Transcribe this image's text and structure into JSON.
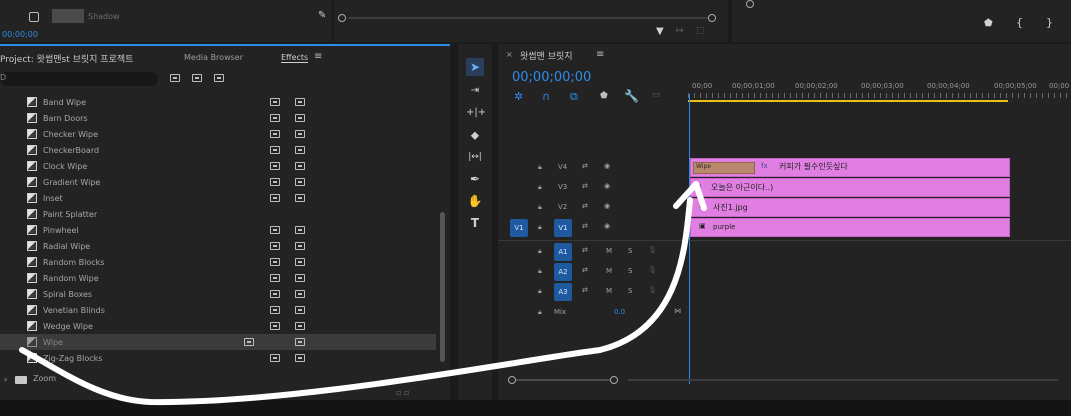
{
  "top": {
    "shadow_label": "Shadow",
    "timecode_left": "00;00;00"
  },
  "project_panel": {
    "tabs": [
      "Project: 왓썹맨st 브릿지 프로젝트",
      "Media Browser",
      "Effects"
    ],
    "menu_icon": "hamburger-icon",
    "search_placeholder": "",
    "search_prefix": "D"
  },
  "effects": {
    "items": [
      {
        "label": "Band Wipe",
        "badges": 2
      },
      {
        "label": "Barn Doors",
        "badges": 2
      },
      {
        "label": "Checker Wipe",
        "badges": 2
      },
      {
        "label": "CheckerBoard",
        "badges": 2
      },
      {
        "label": "Clock Wipe",
        "badges": 2
      },
      {
        "label": "Gradient Wipe",
        "badges": 2
      },
      {
        "label": "Inset",
        "badges": 2
      },
      {
        "label": "Paint Splatter",
        "badges": 0
      },
      {
        "label": "Pinwheel",
        "badges": 2
      },
      {
        "label": "Radial Wipe",
        "badges": 2
      },
      {
        "label": "Random Blocks",
        "badges": 2
      },
      {
        "label": "Random Wipe",
        "badges": 2
      },
      {
        "label": "Spiral Boxes",
        "badges": 2
      },
      {
        "label": "Venetian Blinds",
        "badges": 2
      },
      {
        "label": "Wedge Wipe",
        "badges": 2
      },
      {
        "label": "Wipe",
        "badges": 3,
        "selected": true
      },
      {
        "label": "Zig-Zag Blocks",
        "badges": 2
      }
    ],
    "folder_zoom": "Zoom"
  },
  "timeline": {
    "sequence_name": "왓썹맨 브릿지",
    "timecode": "00;00;00;00",
    "ruler": [
      "00;00",
      "00;00;01;00",
      "00;00;02;00",
      "00;00;03;00",
      "00;00;04;00",
      "00;00;05;00",
      "00;00"
    ],
    "video_tracks": [
      "V4",
      "V3",
      "V2",
      "V1"
    ],
    "audio_tracks": [
      "A1",
      "A2",
      "A3"
    ],
    "mix_label": "Mix",
    "mix_value": "0.0",
    "source_v1": "V1",
    "track_buttons": {
      "mute": "M",
      "solo": "S"
    },
    "clips": {
      "v4_transition": "Wipe",
      "v4_title": "커피가 필수인듯싶다",
      "v3_title": "오늘은 아근이다..)",
      "v2_image": "사진1.jpg",
      "v1_matte": "purple"
    }
  },
  "colors": {
    "clip_pink": "#e07fe1",
    "accent_blue": "#2d8ceb",
    "target_blue": "#1f5aa0",
    "ruler_yellow": "#e8c21a"
  }
}
